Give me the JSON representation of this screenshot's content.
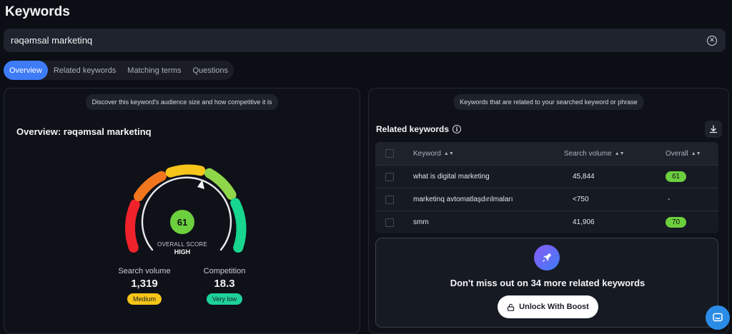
{
  "page": {
    "title": "Keywords"
  },
  "search": {
    "value": "rəqəmsal marketinq"
  },
  "tabs": [
    {
      "label": "Overview",
      "active": true
    },
    {
      "label": "Related keywords"
    },
    {
      "label": "Matching terms"
    },
    {
      "label": "Questions"
    }
  ],
  "overview": {
    "note": "Discover this keyword's audience size and how competitive it is",
    "title": "Overview: rəqəmsal marketinq",
    "score": "61",
    "score_label": "OVERALL SCORE",
    "score_level": "HIGH",
    "search_volume": {
      "label": "Search volume",
      "value": "1,319",
      "badge": "Medium",
      "badge_color": "#f5c518"
    },
    "competition": {
      "label": "Competition",
      "value": "18.3",
      "badge": "Very low",
      "badge_color": "#1ed19a"
    }
  },
  "related": {
    "note": "Keywords that are related to your searched keyword or phrase",
    "title": "Related keywords",
    "columns": {
      "keyword": "Keyword",
      "volume": "Search volume",
      "overall": "Overall"
    },
    "rows": [
      {
        "keyword": "what is digital marketing",
        "volume": "45,844",
        "overall": "61"
      },
      {
        "keyword": "marketinq avtomatlaşdırılmaları",
        "volume": "<750",
        "overall": "-"
      },
      {
        "keyword": "smm",
        "volume": "41,906",
        "overall": "70"
      }
    ],
    "boost_text": "Don't miss out on 34 more related keywords",
    "unlock_label": "Unlock With Boost"
  },
  "colors": {
    "accent": "#3d7bf7",
    "score_green": "#6ccf3e"
  }
}
